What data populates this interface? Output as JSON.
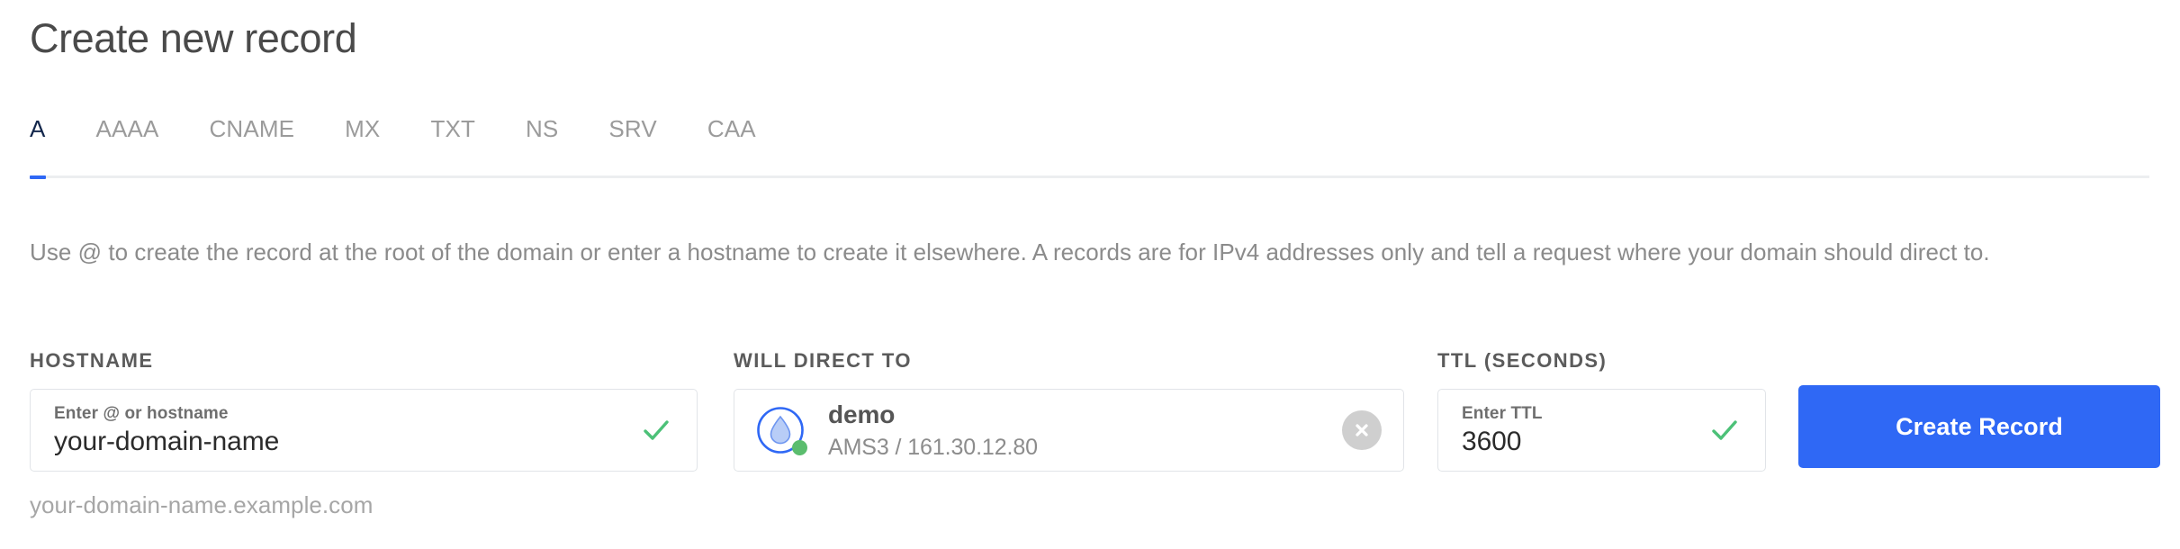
{
  "page": {
    "title": "Create new record"
  },
  "tabs": {
    "active": "A",
    "items": [
      {
        "label": "A",
        "active": true
      },
      {
        "label": "AAAA",
        "active": false
      },
      {
        "label": "CNAME",
        "active": false
      },
      {
        "label": "MX",
        "active": false
      },
      {
        "label": "TXT",
        "active": false
      },
      {
        "label": "NS",
        "active": false
      },
      {
        "label": "SRV",
        "active": false
      },
      {
        "label": "CAA",
        "active": false
      }
    ]
  },
  "description": "Use @ to create the record at the root of the domain or enter a hostname to create it elsewhere. A records are for IPv4 addresses only and tell a request where your domain should direct to.",
  "form": {
    "hostname": {
      "label": "HOSTNAME",
      "placeholder": "Enter @ or hostname",
      "value": "your-domain-name",
      "helper_text": "your-domain-name.example.com",
      "valid": true
    },
    "will_direct_to": {
      "label": "WILL DIRECT TO",
      "resource_name": "demo",
      "resource_detail": "AMS3 / 161.30.12.80",
      "icon": "droplet-icon",
      "status": "active",
      "clear_icon": "clear-circle-icon"
    },
    "ttl": {
      "label": "TTL (SECONDS)",
      "placeholder": "Enter TTL",
      "value": "3600",
      "valid": true
    },
    "submit": {
      "label": "Create Record"
    }
  },
  "colors": {
    "accent_blue": "#2f68f5",
    "active_tab_text": "#12264b",
    "valid_green": "#4cc178",
    "status_green": "#5bbd6e",
    "droplet_blue": "#2f68f5",
    "droplet_fill": "#b8cdf7",
    "muted_text": "#9b9b9b",
    "title_text": "#4a4a4a",
    "border": "#e1e4e8"
  }
}
